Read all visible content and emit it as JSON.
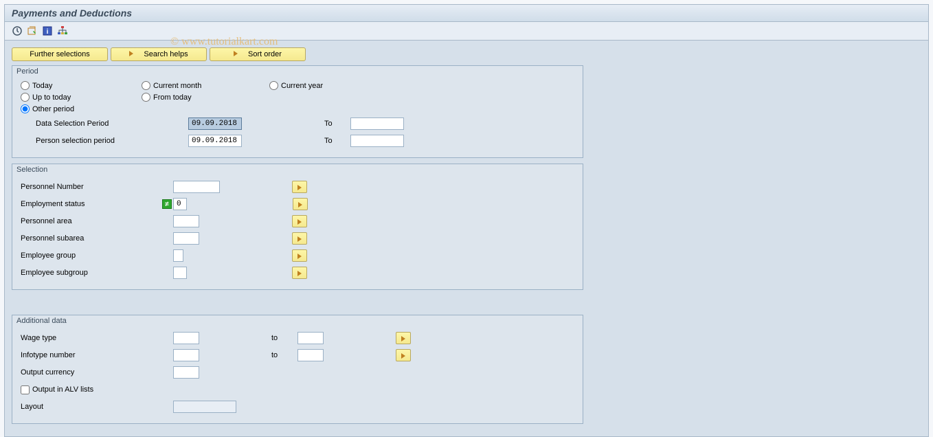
{
  "header": {
    "title": "Payments and Deductions"
  },
  "watermark": "© www.tutorialkart.com",
  "toolbar": {
    "further_selections": "Further selections",
    "search_helps": "Search helps",
    "sort_order": "Sort order"
  },
  "period": {
    "legend": "Period",
    "today": "Today",
    "current_month": "Current month",
    "current_year": "Current year",
    "up_to_today": "Up to today",
    "from_today": "From today",
    "other_period": "Other period",
    "data_sel_label": "Data Selection Period",
    "data_sel_from": "09.09.2018",
    "to": "To",
    "person_sel_label": "Person selection period",
    "person_sel_from": "09.09.2018"
  },
  "selection": {
    "legend": "Selection",
    "personnel_number": "Personnel Number",
    "employment_status": "Employment status",
    "employment_status_val": "0",
    "personnel_area": "Personnel area",
    "personnel_subarea": "Personnel subarea",
    "employee_group": "Employee group",
    "employee_subgroup": "Employee subgroup"
  },
  "additional": {
    "legend": "Additional data",
    "wage_type": "Wage type",
    "to": "to",
    "infotype_number": "Infotype number",
    "output_currency": "Output currency",
    "output_alv": "Output in ALV lists",
    "layout": "Layout"
  }
}
